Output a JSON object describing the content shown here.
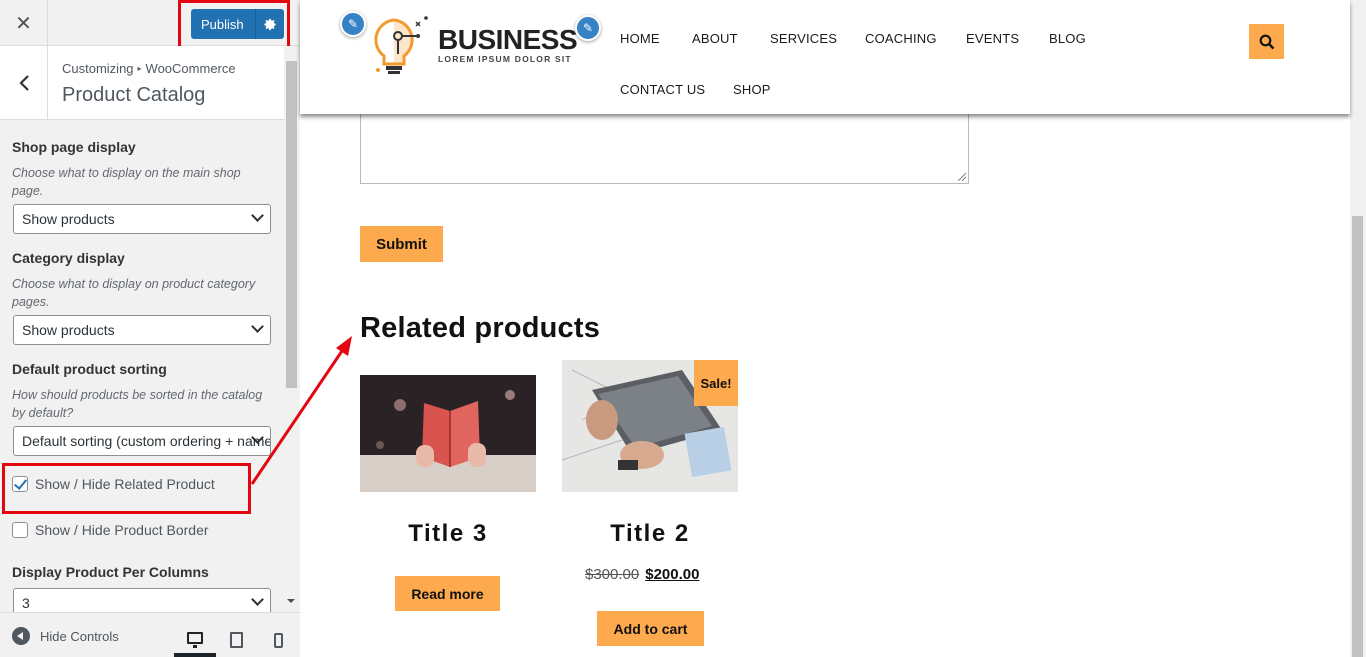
{
  "customizer": {
    "close_icon": "close-icon",
    "publish_label": "Publish",
    "breadcrumb_root": "Customizing",
    "breadcrumb_section": "WooCommerce",
    "section_title": "Product Catalog",
    "shop_display": {
      "label": "Shop page display",
      "description": "Choose what to display on the main shop page.",
      "value": "Show products"
    },
    "category_display": {
      "label": "Category display",
      "description": "Choose what to display on product category pages.",
      "value": "Show products"
    },
    "sorting": {
      "label": "Default product sorting",
      "description": "How should products be sorted in the catalog by default?",
      "value": "Default sorting (custom ordering + name)"
    },
    "related_toggle": {
      "label": "Show / Hide Related Product",
      "checked": true
    },
    "border_toggle": {
      "label": "Show / Hide Product Border",
      "checked": false
    },
    "columns": {
      "label": "Display Product Per Columns",
      "value": "3"
    },
    "footer": {
      "hide_controls_label": "Hide Controls",
      "devices": [
        "desktop",
        "tablet",
        "mobile"
      ],
      "active_device": "desktop"
    }
  },
  "site": {
    "logo_title": "BUSINESS",
    "logo_subtitle": "LOREM IPSUM DOLOR SIT",
    "nav": [
      "HOME",
      "ABOUT",
      "SERVICES",
      "COACHING",
      "EVENTS",
      "BLOG",
      "CONTACT US",
      "SHOP"
    ],
    "submit_label": "Submit",
    "related_heading": "Related products",
    "products": [
      {
        "title": "Title 3",
        "button": "Read more",
        "sale": false
      },
      {
        "title": "Title 2",
        "old_price": "$300.00",
        "price": "$200.00",
        "button": "Add to cart",
        "sale": true,
        "sale_label": "Sale!"
      }
    ]
  },
  "colors": {
    "accent": "#fda94d",
    "publish_blue": "#2271b1",
    "annotation_red": "#e3050f"
  }
}
